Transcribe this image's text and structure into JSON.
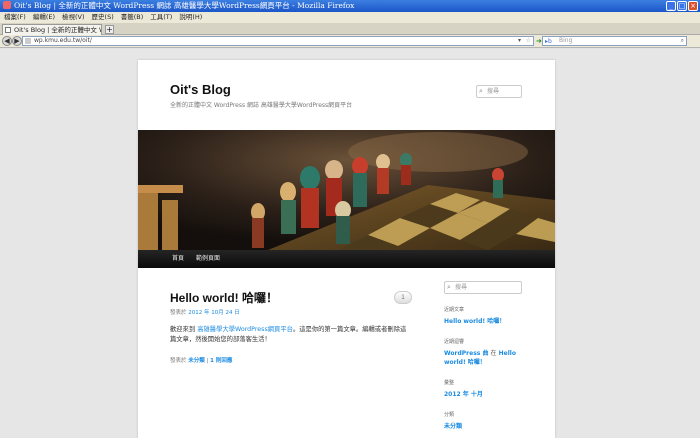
{
  "window": {
    "title": "Oit's Blog | 全新的正體中文 WordPress 網誌 高雄醫學大學WordPress網頁平台 - Mozilla Firefox"
  },
  "menubar": {
    "items": [
      "檔案(F)",
      "編輯(E)",
      "檢視(V)",
      "歷史(S)",
      "書籤(B)",
      "工具(T)",
      "說明(H)"
    ]
  },
  "tabs": [
    {
      "label": "Oit's Blog | 全新的正體中文 W..."
    }
  ],
  "navbar": {
    "url": "wp.kmu.edu.tw/oit/",
    "search_placeholder": "Bing"
  },
  "blog": {
    "title": "Oit's Blog",
    "tagline": "全新的正體中文 WordPress 網誌 高雄醫學大學WordPress網頁平台",
    "header_search_placeholder": "搜尋",
    "nav": [
      "首頁",
      "範例頁面"
    ]
  },
  "post": {
    "title": "Hello world! 哈囉！",
    "comment_count": "1",
    "meta_prefix": "發表於",
    "date": "2012 年 10月 24 日",
    "content_before_link": "歡迎來到",
    "content_link": "高雄醫學大學WordPress網頁平台",
    "content_after_link": "。這是你的第一篇文章。編輯或者刪除這篇文章，然後開始您的部落客生活！",
    "footer_prefix": "發表於",
    "category": "未分類",
    "comments_link": "1 則回應"
  },
  "sidebar": {
    "search_placeholder": "搜尋",
    "recent_posts_title": "近期文章",
    "recent_post": "Hello world! 哈囉！",
    "recent_comments_title": "近期迴響",
    "comment_author": "WordPress 曲",
    "comment_on": "在",
    "comment_post": "Hello world! 哈囉！",
    "archives_title": "彙整",
    "archive": "2012 年 十月",
    "categories_title": "分類",
    "category": "未分類"
  },
  "colors": {
    "link": "#1b8be0",
    "titlebar": "#1c56c8"
  }
}
